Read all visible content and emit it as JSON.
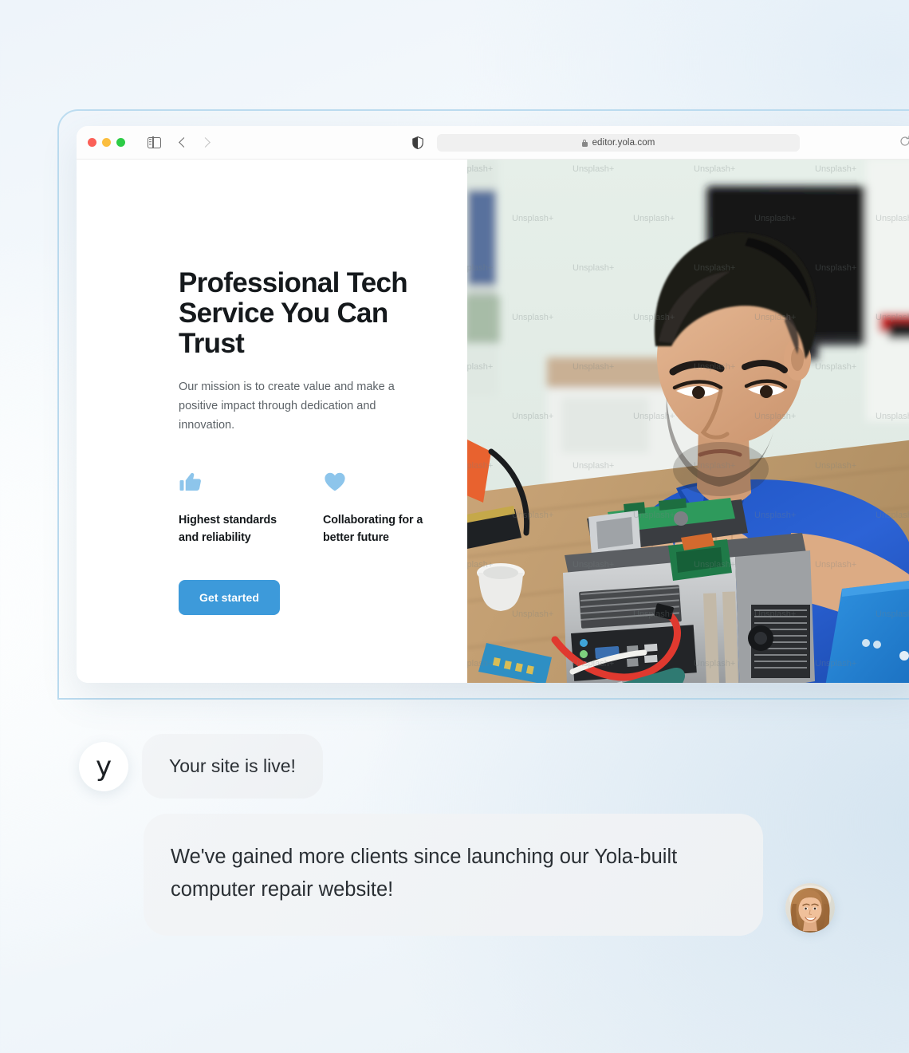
{
  "browser": {
    "traffic_lights": [
      "close",
      "minimize",
      "maximize"
    ],
    "sidebar_toggle": "sidebar-toggle-icon",
    "back_label": "Back",
    "forward_label": "Forward",
    "shield_icon": "shield-icon",
    "lock_icon": "lock-icon",
    "url": "editor.yola.com",
    "reload_icon": "reload-icon"
  },
  "site": {
    "headline": "Professional Tech Service You Can Trust",
    "subcopy": "Our mission is to create value and make a positive impact through dedication and innovation.",
    "features": [
      {
        "icon": "thumbs-up-icon",
        "label": "Highest standards and reliability"
      },
      {
        "icon": "heart-icon",
        "label": "Collaborating for a better future"
      }
    ],
    "cta_label": "Get started",
    "photo": {
      "alt": "Technician in blue polo shirt repairing a desktop computer at a workbench",
      "watermark": "Unsplash+"
    }
  },
  "chat": {
    "brand_initial": "y",
    "messages": [
      {
        "from": "yola",
        "text": "Your site is live!"
      },
      {
        "from": "customer",
        "text": "We've gained more clients since launching our Yola-built computer repair website!"
      }
    ]
  },
  "colors": {
    "accent": "#3d9ada",
    "icon_blue": "#8dc5eb",
    "heading": "#15191c",
    "body_text": "#5d6368",
    "frame_border": "#bcdcf0",
    "bubble_bg": "#f0f3f6"
  }
}
